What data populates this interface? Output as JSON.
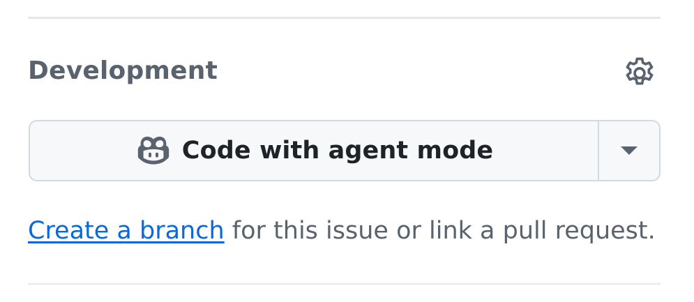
{
  "development": {
    "title": "Development",
    "settings_icon": "gear-icon",
    "agent_button": {
      "icon": "copilot-icon",
      "label": "Code with agent mode",
      "dropdown_icon": "triangle-down-icon"
    },
    "description": {
      "link_text": "Create a branch",
      "rest_text": " for this issue or link a pull request."
    }
  },
  "colors": {
    "title": "#59636e",
    "link": "#0969da",
    "button_bg": "#f6f8fa",
    "button_border": "#d1d9e0",
    "button_text": "#1f2328"
  }
}
